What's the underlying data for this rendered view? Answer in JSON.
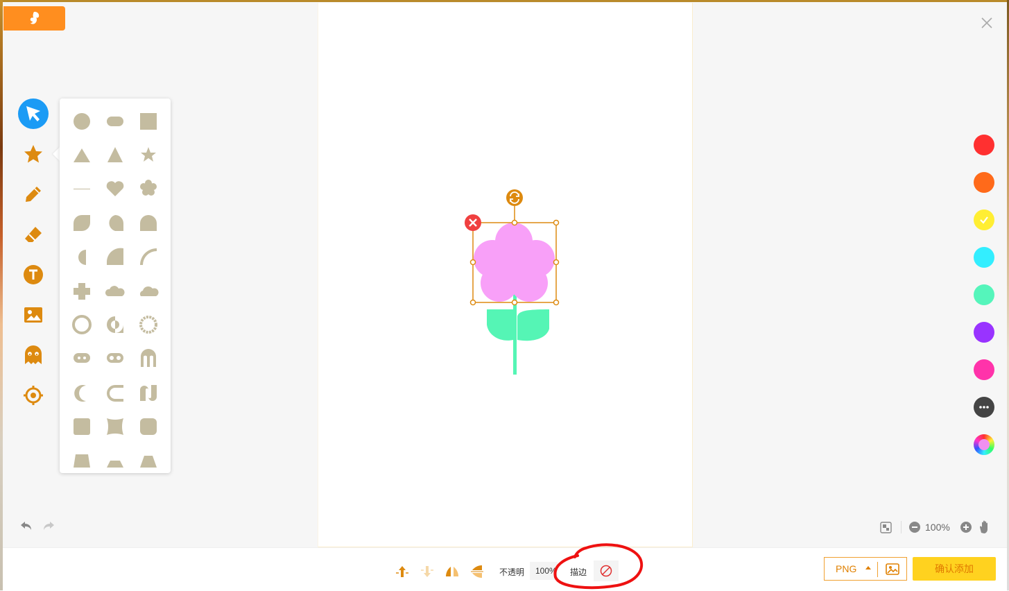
{
  "header": {
    "logo_icon": "squirrel-logo-icon",
    "close_icon": "close-icon"
  },
  "tools": [
    {
      "name": "select",
      "icon": "cursor-icon",
      "active": true
    },
    {
      "name": "shapes",
      "icon": "star-icon"
    },
    {
      "name": "pen",
      "icon": "pencil-icon"
    },
    {
      "name": "eraser",
      "icon": "eraser-icon"
    },
    {
      "name": "text",
      "icon": "text-icon"
    },
    {
      "name": "image",
      "icon": "image-icon"
    },
    {
      "name": "sticker",
      "icon": "ghost-icon"
    },
    {
      "name": "locate",
      "icon": "target-icon"
    }
  ],
  "shape_panel": {
    "shapes": [
      "circle",
      "pill",
      "square",
      "triangle",
      "tall-triangle",
      "star",
      "line",
      "heart",
      "flower",
      "leaf",
      "tear-drop",
      "arch",
      "half-circle",
      "quarter-circle",
      "arc",
      "cross",
      "cloud-small",
      "cloud",
      "ring",
      "speech-ring",
      "cog-ring",
      "rounded-pill-eyes",
      "infinity-pill",
      "m-shape",
      "crescent",
      "c-shape",
      "wave-shape",
      "rounded-square",
      "concave-square",
      "rounded-tile",
      "trapezoid",
      "trapezoid-short",
      "trapezoid-wide"
    ]
  },
  "canvas": {
    "shape_fill": "#f8a0f8",
    "stem_fill": "#55f5b5",
    "selection_color": "#dd8a10",
    "delete_icon": "delete-x-icon",
    "rotate_icon": "rotate-icon"
  },
  "palette": {
    "colors": [
      "#ff3030",
      "#ff6a1a",
      "#ffee33",
      "#33eeff",
      "#55f5bb",
      "#9933ff",
      "#ff33aa"
    ],
    "selected": "#ffee33",
    "more_icon": "more-dots-icon",
    "picker_icon": "color-wheel-icon"
  },
  "history": {
    "undo_icon": "undo-icon",
    "redo_icon": "redo-icon"
  },
  "zoom": {
    "value": "100%"
  },
  "toolbar": {
    "layer_up_icon": "bring-forward-icon",
    "layer_down_icon": "send-backward-icon",
    "flip_h_icon": "flip-horizontal-icon",
    "flip_v_icon": "flip-vertical-icon",
    "opacity_label": "不透明",
    "opacity_value": "100%",
    "stroke_label": "描边",
    "stroke_icon": "no-stroke-icon"
  },
  "export": {
    "format": "PNG",
    "confirm_label": "确认添加"
  },
  "colors": {
    "accent": "#dd8a10",
    "brand": "#ff8e1f",
    "confirm_bg": "#ffd21f",
    "annotation": "#ee1111"
  }
}
